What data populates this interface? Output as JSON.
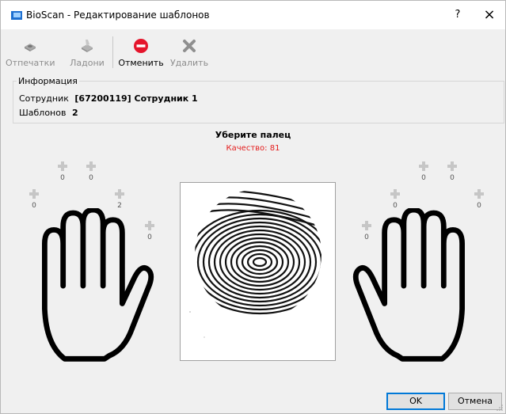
{
  "window": {
    "title": "BioScan - Редактирование шаблонов",
    "help_button": "?",
    "close_button": "×"
  },
  "toolbar": [
    {
      "id": "fingerprints",
      "label": "Отпечатки",
      "icon": "fingerprint-scanner-icon",
      "enabled": false
    },
    {
      "id": "palms",
      "label": "Ладони",
      "icon": "palm-scanner-icon",
      "enabled": false
    },
    {
      "id": "cancel",
      "label": "Отменить",
      "icon": "no-entry-icon",
      "enabled": true
    },
    {
      "id": "delete",
      "label": "Удалить",
      "icon": "delete-x-icon",
      "enabled": false
    }
  ],
  "info": {
    "legend": "Информация",
    "employee_label": "Сотрудник",
    "employee_value": "[67200119] Сотрудник 1",
    "templates_label": "Шаблонов",
    "templates_value": "2"
  },
  "status": {
    "title": "Уберите палец",
    "quality": "Качество: 81"
  },
  "left_hand_counts": [
    "0",
    "0",
    "0",
    "2",
    "0"
  ],
  "right_hand_counts": [
    "0",
    "0",
    "0",
    "0",
    "0"
  ],
  "buttons": {
    "ok": "OK",
    "cancel": "Отмена"
  },
  "colors": {
    "cancel_icon": "#e5142b",
    "quality_text": "#e41c1c",
    "primary_border": "#0078d7"
  }
}
